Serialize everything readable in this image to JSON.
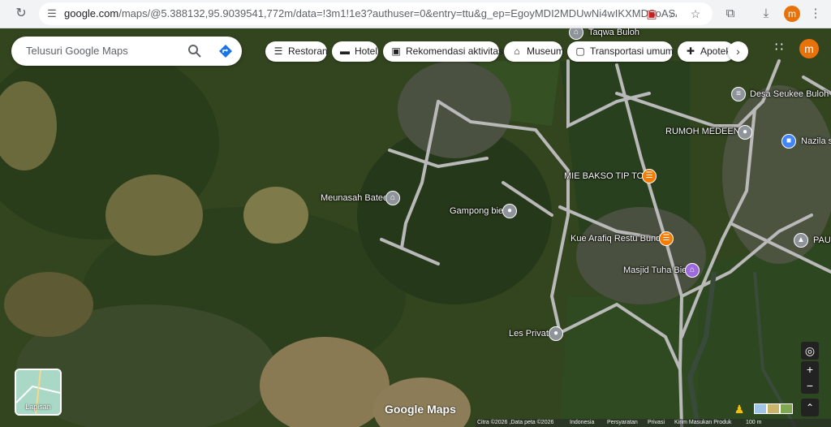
{
  "browser": {
    "url_domain": "google.com",
    "url_rest": "/maps/@5.388132,95.9039541,772m/data=!3m1!1e3?authuser=0&entry=ttu&g_ep=EgoyMDI2MDUwNi4wIKXMDSoASAF...",
    "profile_initial": "m"
  },
  "search": {
    "placeholder": "Telusuri Google Maps"
  },
  "chips": [
    {
      "label": "Restoran",
      "icon": "fork-knife-icon"
    },
    {
      "label": "Hotel",
      "icon": "bed-icon"
    },
    {
      "label": "Rekomendasi aktivitas",
      "icon": "camera-icon"
    },
    {
      "label": "Museum",
      "icon": "museum-icon"
    },
    {
      "label": "Transportasi umum",
      "icon": "bus-icon"
    },
    {
      "label": "Apotek",
      "icon": "pharmacy-icon"
    }
  ],
  "account": {
    "initial": "m"
  },
  "places": [
    {
      "name": "Taqwa Buloh",
      "type": "mosque",
      "color": "#8e9499"
    },
    {
      "name": "Desa Seukee Buloh",
      "type": "government",
      "color": "#8e9499"
    },
    {
      "name": "RUMOH MEDEENA",
      "type": "generic",
      "color": "#8e9499"
    },
    {
      "name": "Nazila s",
      "type": "shopping",
      "color": "#4285f4"
    },
    {
      "name": "MIE BAKSO TIP TOP",
      "type": "restaurant",
      "color": "#f57c00"
    },
    {
      "name": "Meunasah Batee",
      "type": "mosque",
      "color": "#8e9499"
    },
    {
      "name": "Gampong bie",
      "type": "generic",
      "color": "#8e9499"
    },
    {
      "name": "Kue Arafiq Restu Bunda",
      "type": "restaurant",
      "color": "#f57c00"
    },
    {
      "name": "PAUD",
      "type": "school",
      "color": "#8e9499"
    },
    {
      "name": "Masjid Tuha Bie",
      "type": "place-of-worship",
      "color": "#9c6ade"
    },
    {
      "name": "Les Privat",
      "type": "generic",
      "color": "#8e9499"
    }
  ],
  "layers": {
    "label": "Lapisan"
  },
  "brand": "Google Maps",
  "footer": {
    "copyright": "Citra ©2026 ,Data peta ©2026",
    "links": [
      "Indonesia",
      "Persyaratan",
      "Privasi",
      "Kirim Masukan Produk"
    ],
    "scale": "100 m"
  }
}
